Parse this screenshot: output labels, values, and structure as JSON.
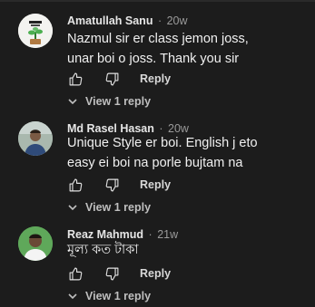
{
  "colors": {
    "background": "#1c1c1c",
    "text_primary": "#f0f0f0",
    "text_secondary": "#9a9a9a",
    "action_text": "#d8d8d8"
  },
  "comments": [
    {
      "author": "Amatullah Sanu",
      "separator": "·",
      "time": "20w",
      "lines": [
        "Nazmul sir er class jemon joss,",
        "unar boi o joss. Thank you sir"
      ],
      "avatar": "plant-avatar",
      "reply_label": "Reply",
      "view_replies_label": "View 1 reply"
    },
    {
      "author": "Md Rasel Hasan",
      "separator": "·",
      "time": "20w",
      "lines": [
        "Unique Style er boi. English j eto",
        "easy ei boi na porle bujtam na"
      ],
      "avatar": "person-avatar",
      "reply_label": "Reply",
      "view_replies_label": "View 1 reply"
    },
    {
      "author": "Reaz Mahmud",
      "separator": "·",
      "time": "21w",
      "lines": [
        "মূল্য কত টাকা"
      ],
      "avatar": "person-avatar",
      "reply_label": "Reply",
      "view_replies_label": "View 1 reply"
    }
  ],
  "icons": {
    "like": "thumbs-up-icon",
    "dislike": "thumbs-down-icon",
    "expand": "chevron-down-icon"
  }
}
